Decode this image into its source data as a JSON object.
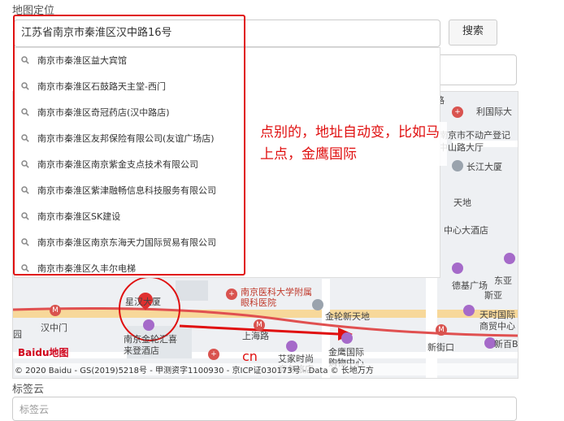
{
  "section": {
    "label": "地图定位"
  },
  "search": {
    "value": "江苏省南京市秦淮区汉中路16号",
    "button": "搜索"
  },
  "suggestions": [
    "南京市秦淮区益大宾馆",
    "南京市秦淮区石鼓路天主堂-西门",
    "南京市秦淮区奇冠药店(汉中路店)",
    "南京市秦淮区友邦保险有限公司(友谊广场店)",
    "南京市秦淮区南京紫金支点技术有限公司",
    "南京市秦淮区紫津融畅信息科技服务有限公司",
    "南京市秦淮区SK建设",
    "南京市秦淮区南京东海天力国际贸易有限公司",
    "南京市秦淮区久丰尔电梯"
  ],
  "annotation": {
    "note": "点别的，地址自动变，比如马上点，金鹰国际",
    "marker_text": "cn"
  },
  "map": {
    "pois": {
      "hospital": "南京医科大学附属眼科医院",
      "hospital2": "南京医科大学",
      "jinlun": "金轮新天地",
      "shanghai": "上海路",
      "aijia": "艾家时尚商务旅店",
      "jinying": "金鹰国际购物中心",
      "xinjiekou": "新街口",
      "tiantian": "天时国际商贸中心",
      "xinbaibai": "新百B座",
      "hanzhongmen": "汉中门",
      "jinlinghui": "南京金轮汇喜来登酒店",
      "star": "星汉大厦",
      "road": "路",
      "lili": "利国际大",
      "nanjingbudongchan": "南京市不动产登记中山路大厅",
      "changjiang": "长江大厦",
      "tianhua": "天地",
      "center": "中心大酒店",
      "shanggang": "德基广场",
      "dongya": "东亚",
      "sheng": "斯亚",
      "yuan": "园",
      "tiantian_short": "天时国际"
    },
    "attribution": "© 2020 Baidu - GS(2019)5218号 - 甲测资字1100930 - 京ICP证030173号 - Data © 长地万方",
    "logo": "Baidu地图"
  },
  "tags": {
    "label": "标签云",
    "placeholder": "标签云"
  },
  "colors": {
    "accent_red": "#e01010",
    "route_red": "#e05050"
  }
}
